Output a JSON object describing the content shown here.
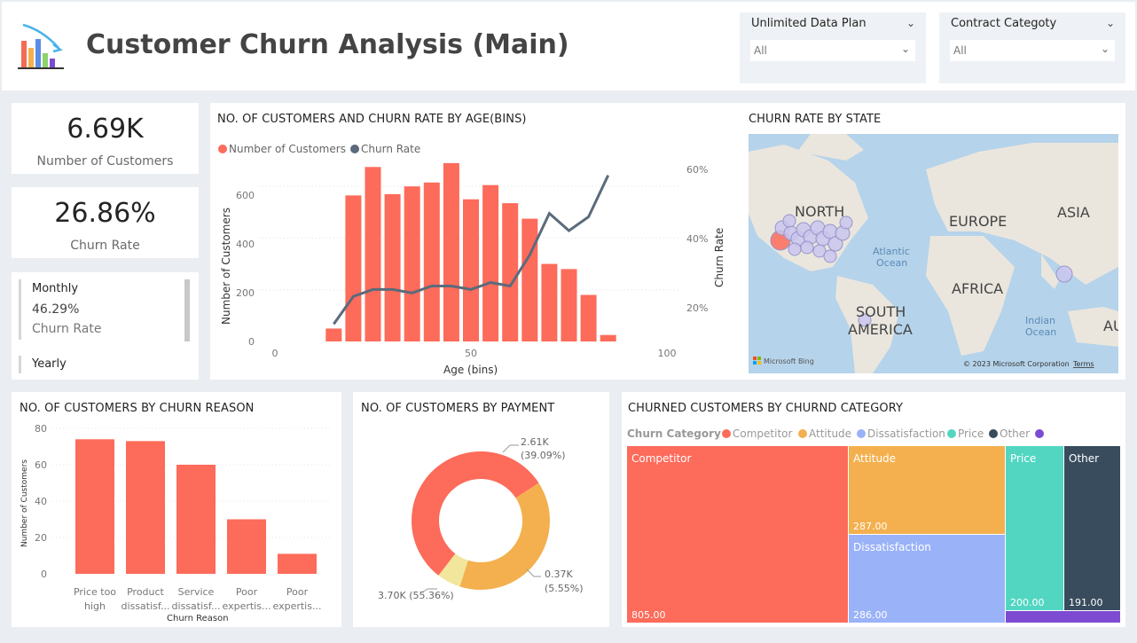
{
  "header": {
    "title": "Customer Churn Analysis (Main)"
  },
  "slicers": [
    {
      "title": "Unlimited Data Plan",
      "value": "All"
    },
    {
      "title": "Contract Categoty",
      "value": "All"
    }
  ],
  "kpis": {
    "customers": {
      "value": "6.69K",
      "label": "Number of Customers"
    },
    "churn_rate": {
      "value": "26.86%",
      "label": "Churn Rate"
    }
  },
  "contract_card": {
    "items": [
      {
        "name": "Monthly",
        "value": "46.29%",
        "label": "Churn Rate"
      },
      {
        "name": "Yearly"
      }
    ]
  },
  "age_chart": {
    "title": "NO. OF CUSTOMERS AND CHURN RATE BY AGE(BINS)",
    "legend": [
      "Number of Customers",
      "Churn Rate"
    ],
    "ylabel": "Number of Customers",
    "y2label": "Churn Rate",
    "xlabel": "Age (bins)",
    "xticks": [
      "0",
      "50",
      "100"
    ],
    "yticks": [
      "0",
      "200",
      "400",
      "600"
    ],
    "y2ticks": [
      "20%",
      "40%",
      "60%"
    ]
  },
  "state_map": {
    "title": "CHURN RATE BY STATE",
    "labels": {
      "north": "NORTH",
      "europe": "EUROPE",
      "asia": "ASIA",
      "africa": "AFRICA",
      "south": "SOUTH",
      "america": "AMERICA",
      "aus": "AUS",
      "atlantic1": "Atlantic",
      "atlantic2": "Ocean",
      "indian1": "Indian",
      "indian2": "Ocean"
    },
    "bing": "Microsoft Bing",
    "copyright": "© 2023 Microsoft Corporation",
    "terms": "Terms"
  },
  "reason_chart": {
    "title": "NO. OF CUSTOMERS BY CHURN REASON",
    "ylabel": "Number of Customers",
    "xlabel": "Churn Reason",
    "yticks": [
      "0",
      "20",
      "40",
      "60",
      "80"
    ],
    "cat_lines": [
      [
        "Price too",
        "high"
      ],
      [
        "Product",
        "dissatisf..."
      ],
      [
        "Service",
        "dissatisf..."
      ],
      [
        "Poor",
        "expertis..."
      ],
      [
        "Poor",
        "expertis..."
      ]
    ]
  },
  "payment_chart": {
    "title": "NO. OF CUSTOMERS BY PAYMENT",
    "labels": [
      {
        "line1": "2.61K",
        "line2": "(39.09%)"
      },
      {
        "line1": "0.37K",
        "line2": "(5.55%)"
      },
      {
        "line1": "3.70K (55.36%)",
        "line2": ""
      }
    ]
  },
  "category_chart": {
    "title": "CHURNED CUSTOMERS BY CHURND CATEGORY",
    "legend_title": "Churn Category",
    "legend": [
      "Competitor",
      "Attitude",
      "Dissatisfaction",
      "Price",
      "Other"
    ]
  },
  "chart_data": [
    {
      "type": "bar",
      "title": "NO. OF CUSTOMERS AND CHURN RATE BY AGE(BINS)",
      "xlabel": "Age (bins)",
      "ylabel": "Number of Customers",
      "y2label": "Churn Rate",
      "xlim": [
        0,
        100
      ],
      "ylim": [
        0,
        700
      ],
      "y2lim": [
        10,
        65
      ],
      "grid": true,
      "legend": "top-left",
      "x": [
        15,
        20,
        25,
        30,
        35,
        40,
        45,
        50,
        55,
        60,
        65,
        70,
        75,
        80,
        85
      ],
      "series": [
        {
          "name": "Number of Customers",
          "type": "bar",
          "color": "#fd6b5a",
          "values": [
            50,
            565,
            675,
            570,
            600,
            615,
            690,
            550,
            605,
            535,
            475,
            300,
            280,
            180,
            25
          ]
        },
        {
          "name": "Churn Rate",
          "type": "line",
          "color": "#5b6b7b",
          "values": [
            14,
            22,
            24,
            24,
            23,
            25,
            25,
            24,
            26,
            25,
            34,
            46,
            41,
            45,
            57
          ]
        }
      ]
    },
    {
      "type": "bar",
      "title": "NO. OF CUSTOMERS BY CHURN REASON",
      "xlabel": "Churn Reason",
      "ylabel": "Number of Customers",
      "ylim": [
        0,
        80
      ],
      "categories": [
        "Price too high",
        "Product dissatisf...",
        "Service dissatisf...",
        "Poor expertis...",
        "Poor expertis..."
      ],
      "values": [
        74,
        73,
        60,
        30,
        11
      ],
      "color": "#fd6b5a"
    },
    {
      "type": "pie",
      "title": "NO. OF CUSTOMERS BY PAYMENT",
      "labels": [
        "3.70K (55.36%)",
        "2.61K (39.09%)",
        "0.37K (5.55%)"
      ],
      "values": [
        3.7,
        2.61,
        0.37
      ],
      "colors": [
        "#fd6b5a",
        "#f4b04e",
        "#f2e59c"
      ]
    },
    {
      "type": "heatmap",
      "title": "CHURNED CUSTOMERS BY CHURND CATEGORY",
      "categories": [
        "Competitor",
        "Attitude",
        "Dissatisfaction",
        "Price",
        "Other"
      ],
      "values": [
        805.0,
        287.0,
        286.0,
        200.0,
        191.0
      ],
      "labels": [
        "805.00",
        "287.00",
        "286.00",
        "200.00",
        "191.00"
      ],
      "colors": [
        "#fd6b5a",
        "#f4b04e",
        "#9ab2f8",
        "#52d6c2",
        "#384c5d",
        "#7d4bd1"
      ]
    }
  ],
  "colors": {
    "accent": "#fd6b5a",
    "line": "#5b6b7b",
    "attitude": "#f4b04e",
    "dissatisfaction": "#9ab2f8",
    "price": "#52d6c2",
    "other": "#384c5d",
    "extra": "#7d4bd1"
  }
}
